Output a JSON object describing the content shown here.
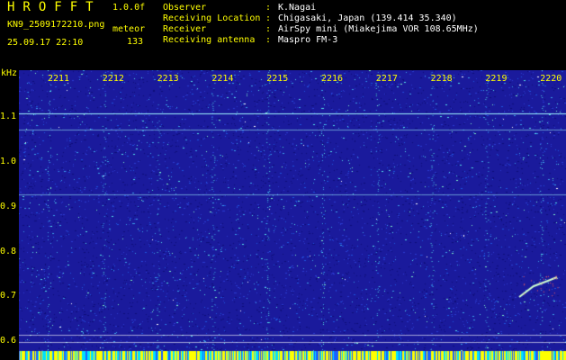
{
  "header": {
    "app_title": "HROFFT",
    "version": "1.0.0f",
    "filename": "KN9_2509172210.png",
    "meteor_label": "meteor",
    "datetime": "25.09.17 22:10",
    "meteor_count": "133"
  },
  "info": [
    {
      "key": "Observer",
      "sep": ":",
      "value": "K.Nagai"
    },
    {
      "key": "Receiving Location",
      "sep": ":",
      "value": "Chigasaki, Japan (139.414 35.340)"
    },
    {
      "key": "Receiver",
      "sep": ":",
      "value": "AirSpy mini (Miakejima VOR 108.65MHz)"
    },
    {
      "key": "Receiving antenna",
      "sep": ":",
      "value": "Maspro FM-3"
    }
  ],
  "axis": {
    "y_unit": "kHz",
    "y_ticks": [
      "1.1",
      "1.0",
      "0.9",
      "0.8",
      "0.7",
      "0.6"
    ],
    "x_ticks": [
      "2211",
      "2212",
      "2213",
      "2214",
      "2215",
      "2216",
      "2217",
      "2218",
      "2219",
      "2220"
    ]
  },
  "colors": {
    "background": "#000000",
    "label": "#ffff00",
    "text": "#ffffff",
    "spectrogram": "#1a1a9c",
    "line": "#9ff5ff"
  }
}
